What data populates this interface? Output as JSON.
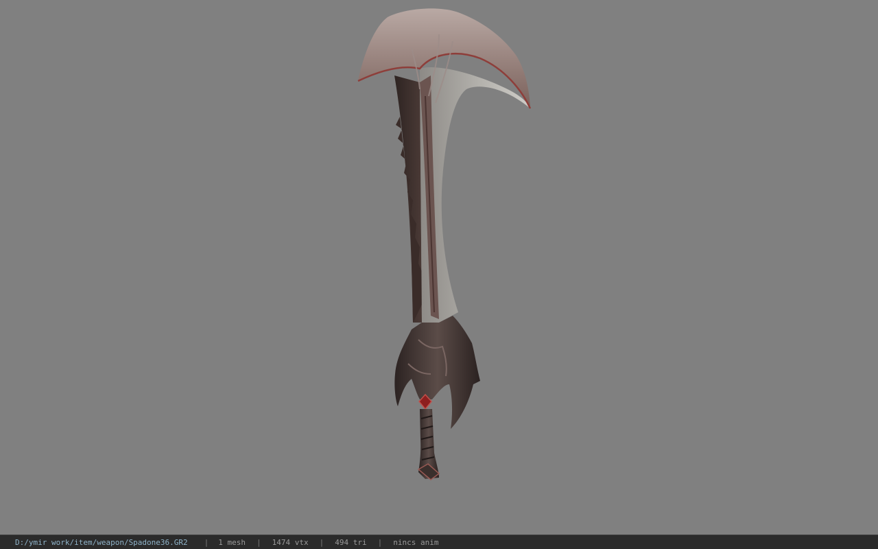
{
  "viewer": {
    "background_color": "#808080",
    "model_icon": "curved-greatsword-model"
  },
  "status_bar": {
    "file_path": "D:/ymir work/item/weapon/Spadone36.GR2",
    "separator": "|",
    "mesh_count": "1 mesh",
    "vertex_count": "1474 vtx",
    "triangle_count": "494 tri",
    "animation": "nincs anim"
  }
}
